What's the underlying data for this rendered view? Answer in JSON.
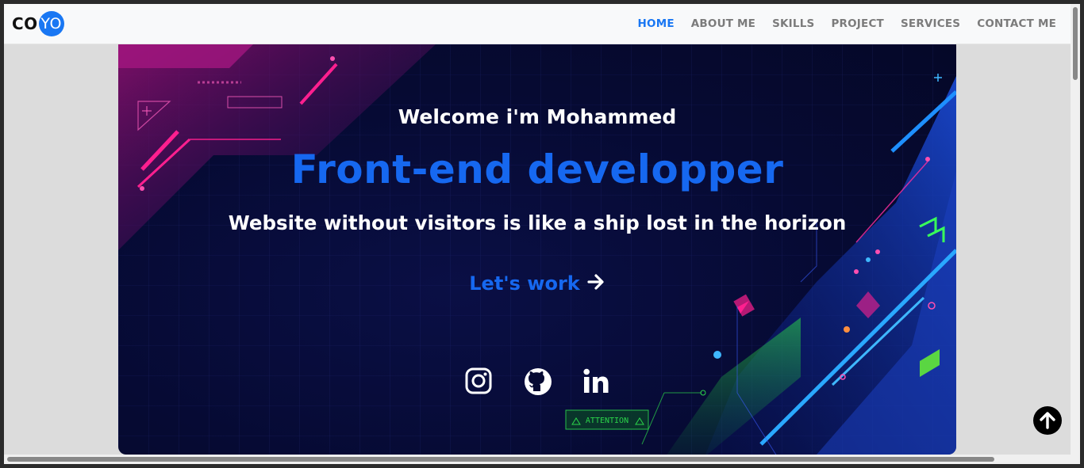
{
  "brand": {
    "part1": "CO",
    "part2": "YO"
  },
  "nav": {
    "items": [
      {
        "label": "HOME",
        "active": true
      },
      {
        "label": "ABOUT ME",
        "active": false
      },
      {
        "label": "SKILLS",
        "active": false
      },
      {
        "label": "PROJECT",
        "active": false
      },
      {
        "label": "SERVICES",
        "active": false
      },
      {
        "label": "CONTACT ME",
        "active": false
      }
    ]
  },
  "hero": {
    "welcome": "Welcome i'm Mohammed",
    "role": "Front-end developper",
    "tagline": "Website without visitors is like a ship lost in the horizon",
    "cta_label": "Let's work",
    "attention_label": "ATTENTION"
  },
  "socials": [
    {
      "icon": "instagram-icon"
    },
    {
      "icon": "github-icon"
    },
    {
      "icon": "linkedin-icon"
    }
  ],
  "colors": {
    "accent": "#1977f3",
    "heading_blue": "#1668f0",
    "nav_text": "#7b7b7b",
    "hero_bg": "#060a33",
    "neon_pink": "#ff1f8f",
    "neon_green": "#2bd44a",
    "neon_blue": "#1e8fff"
  },
  "scroll_top_icon": "arrow-up-icon"
}
